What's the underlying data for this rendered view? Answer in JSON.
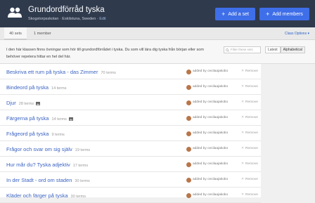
{
  "header": {
    "title": "Grundordförråd tyska",
    "school": "Skogstorpsskolan · Eskilstuna, Sweden ·",
    "edit_label": "Edit",
    "add_set_label": "Add a set",
    "add_members_label": "Add members"
  },
  "tabs": {
    "sets_label": "40 sets",
    "members_label": "1 member",
    "class_options_label": "Class Options ▾"
  },
  "description": "I den här klassen finns övningar som hör till grundordförrådet i tyska. Du som vill lära dig tyska från början eller som behöver repetera hittar en hel del här.",
  "filter": {
    "placeholder": "Filter these sets"
  },
  "sort": {
    "latest_label": "Latest",
    "alphabetical_label": "Alphabetical"
  },
  "sets": [
    {
      "title": "Beskriva ett rum på tyska - das Zimmer",
      "terms": "70 terms",
      "has_images": false,
      "added_by": "added by cecilaajakobo",
      "remove_label": "Remove"
    },
    {
      "title": "Bindeord på tyska",
      "terms": "14 terms",
      "has_images": false,
      "added_by": "added by cecilaajakobo",
      "remove_label": "Remove"
    },
    {
      "title": "Djur",
      "terms": "28 terms",
      "has_images": true,
      "added_by": "added by cecilaajakobo",
      "remove_label": "Remove"
    },
    {
      "title": "Färgerna på tyska",
      "terms": "14 terms",
      "has_images": true,
      "added_by": "added by cecilaajakobo",
      "remove_label": "Remove"
    },
    {
      "title": "Frågeord på tyska",
      "terms": "9 terms",
      "has_images": false,
      "added_by": "added by cecilaajakobo",
      "remove_label": "Remove"
    },
    {
      "title": "Frågor och svar om sig själv",
      "terms": "19 terms",
      "has_images": false,
      "added_by": "added by cecilaajakobo",
      "remove_label": "Remove"
    },
    {
      "title": "Hur mår du? Tyska adjektiv",
      "terms": "17 terms",
      "has_images": false,
      "added_by": "added by cecilaajakobo",
      "remove_label": "Remove"
    },
    {
      "title": "In der Stadt - ord om staden",
      "terms": "30 terms",
      "has_images": false,
      "added_by": "added by cecilaajakobo",
      "remove_label": "Remove"
    },
    {
      "title": "Kläder och färger på tyska",
      "terms": "30 terms",
      "has_images": false,
      "added_by": "added by cecilaajakobo",
      "remove_label": "Remove"
    }
  ],
  "colors": {
    "header_bg": "#2f3a4d",
    "accent": "#3e6ee8",
    "link": "#3a63c2"
  }
}
